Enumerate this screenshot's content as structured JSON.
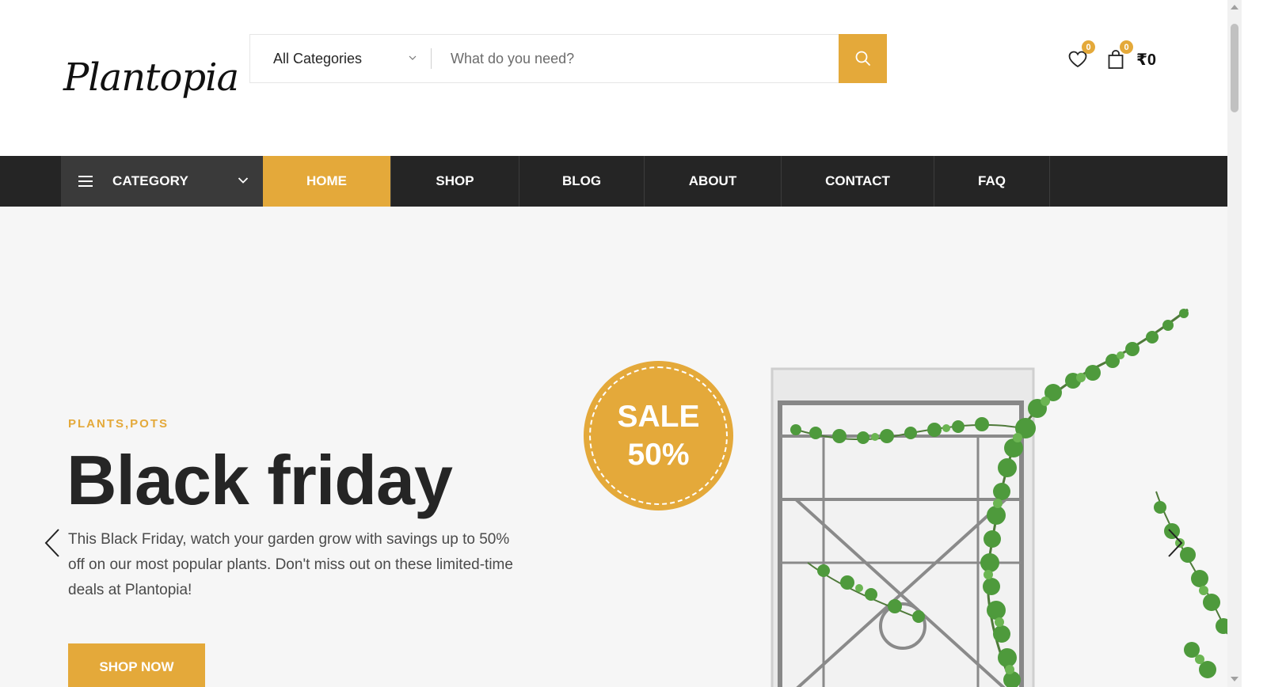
{
  "brand": {
    "logo_text": "Plantopia",
    "accent_color": "#e4a93a",
    "dark_color": "#252525"
  },
  "search": {
    "category_label": "All Categories",
    "placeholder": "What do you need?"
  },
  "header_icons": {
    "wishlist_count": "0",
    "cart_count": "0",
    "cart_total": "₹0"
  },
  "nav": {
    "category_label": "CATEGORY",
    "items": [
      {
        "label": "HOME",
        "active": true
      },
      {
        "label": "SHOP"
      },
      {
        "label": "BLOG"
      },
      {
        "label": "ABOUT"
      },
      {
        "label": "CONTACT"
      },
      {
        "label": "FAQ"
      }
    ]
  },
  "hero": {
    "tag": "PLANTS,POTS",
    "title": "Black friday",
    "description": "This Black Friday, watch your garden grow with savings up to 50% off on our most popular plants. Don't miss out on these limited-time deals at Plantopia!",
    "cta": "SHOP NOW",
    "sale_line1": "SALE",
    "sale_line2": "50%"
  }
}
